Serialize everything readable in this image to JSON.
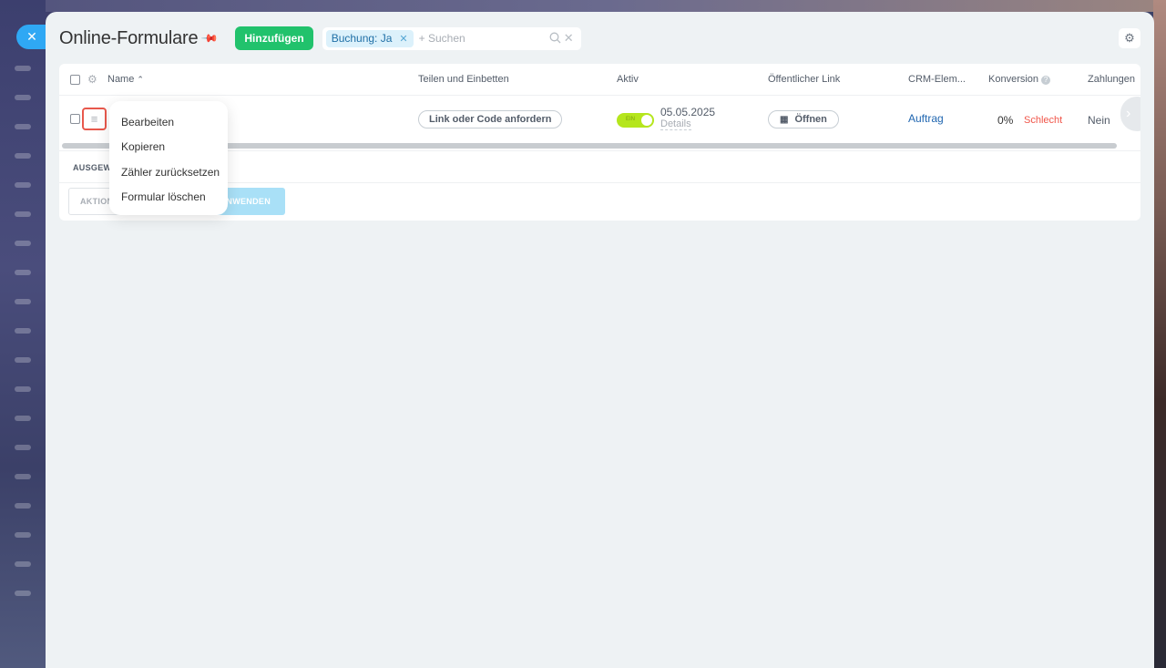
{
  "header": {
    "title": "Online-Formulare",
    "add_button": "Hinzufügen",
    "filter_chip": "Buchung: Ja",
    "search_placeholder": "+ Suchen"
  },
  "grid": {
    "columns": [
      "Name",
      "Teilen und Einbetten",
      "Aktiv",
      "Öffentlicher Link",
      "CRM-Elem...",
      "Konversion",
      "Zahlungen"
    ],
    "row": {
      "share_button": "Link oder Code anfordern",
      "toggle_label": "EIN",
      "active_date": "05.05.2025",
      "details_link": "Details",
      "open_button": "Öffnen",
      "crm_link": "Auftrag",
      "conversion_value": "0%",
      "conversion_status": "Schlecht",
      "payments": "Nein"
    },
    "selected_label": "AUSGEWÄ",
    "actions_label": "AKTION",
    "apply_label": "NWENDEN"
  },
  "context_menu": {
    "items": [
      "Bearbeiten",
      "Kopieren",
      "Zähler zurücksetzen",
      "Formular löschen"
    ]
  },
  "colors": {
    "add_button": "#21c26c",
    "toggle_on": "#b5e61d",
    "danger": "#f0564a",
    "link": "#2066b0"
  }
}
